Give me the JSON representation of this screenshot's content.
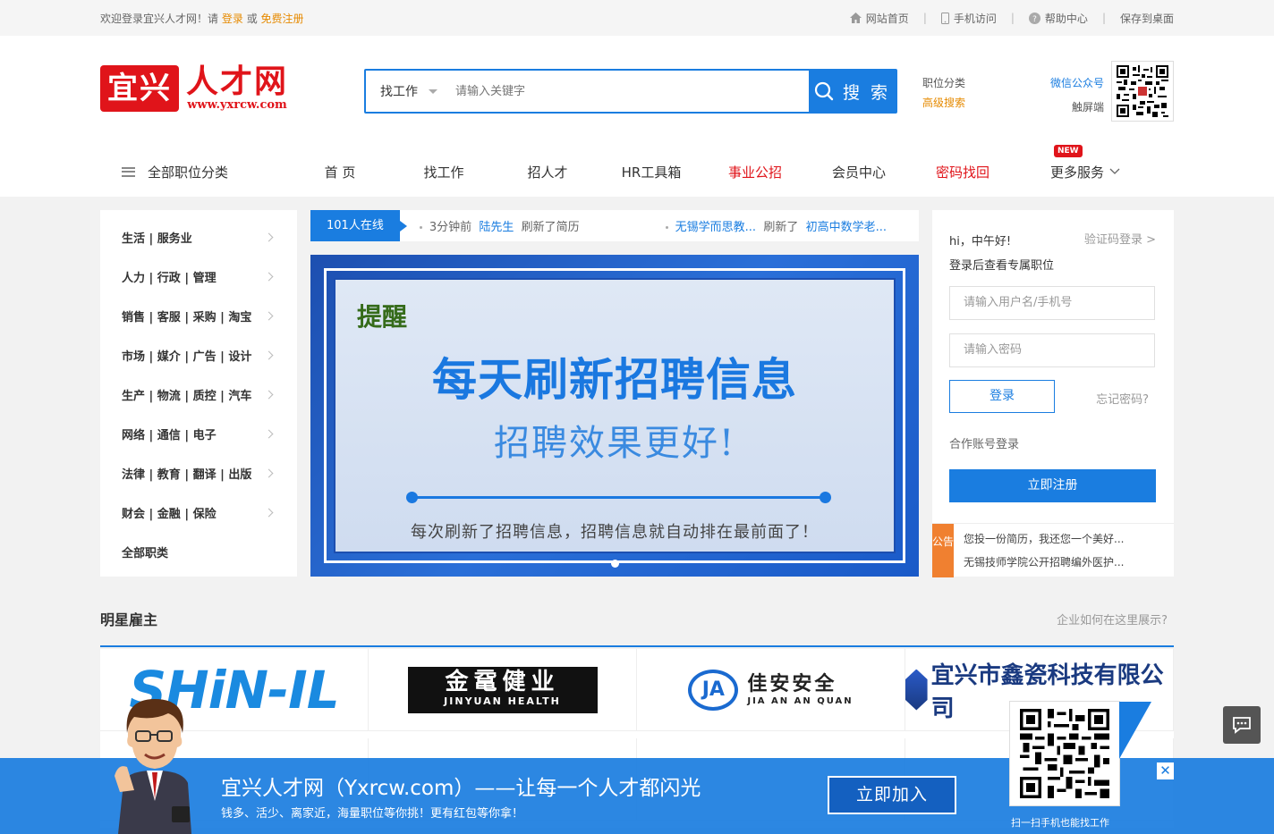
{
  "topbar": {
    "welcome_prefix": "欢迎登录宜兴人才网！请",
    "login": "登录",
    "or": "或",
    "register": "免费注册",
    "links": [
      "网站首页",
      "手机访问",
      "帮助中心",
      "保存到桌面"
    ]
  },
  "logo": {
    "left": "宜兴",
    "right": "人才网",
    "url": "www.yxrcw.com"
  },
  "search": {
    "select": "找工作",
    "placeholder": "请输入关键字",
    "button": "搜 索"
  },
  "adv": {
    "category": "职位分类",
    "advanced": "高级搜索"
  },
  "qr_head": {
    "wechat": "微信公众号",
    "touch": "触屏端"
  },
  "nav": {
    "all_categories": "全部职位分类",
    "items": [
      "首 页",
      "找工作",
      "招人才",
      "HR工具箱",
      "事业公招",
      "会员中心",
      "密码找回"
    ],
    "more": "更多服务",
    "new_badge": "NEW"
  },
  "categories": [
    "生活 | 服务业",
    "人力 | 行政 | 管理",
    "销售 | 客服 | 采购 | 淘宝",
    "市场 | 媒介 | 广告 | 设计",
    "生产 | 物流 | 质控 | 汽车",
    "网络 | 通信 | 电子",
    "法律 | 教育 | 翻译 | 出版",
    "财会 | 金融 | 保险",
    "全部职类"
  ],
  "ticker": {
    "online": "101人在线",
    "item1_time": "3分钟前",
    "item1_user": "陆先生",
    "item1_action": "刷新了简历",
    "item2_company": "无锡学而思教...",
    "item2_action": "刷新了",
    "item2_job": "初高中数学老..."
  },
  "banner": {
    "remind": "提醒",
    "headline": "每天刷新招聘信息",
    "subline": "招聘效果更好!",
    "caption": "每次刷新了招聘信息，招聘信息就自动排在最前面了！"
  },
  "login_panel": {
    "greeting": "hi，中午好!",
    "sub": "登录后查看专属职位",
    "sms_login": "验证码登录 >",
    "user_placeholder": "请输入用户名/手机号",
    "pwd_placeholder": "请输入密码",
    "login_button": "登录",
    "forgot": "忘记密码?",
    "coop": "合作账号登录",
    "register_button": "立即注册"
  },
  "notice": {
    "tag": "公告",
    "items": [
      "您投一份简历，我还您一个美好...",
      "无锡技师学院公开招聘编外医护..."
    ]
  },
  "stars": {
    "title": "明星雇主",
    "question": "企业如何在这里展示?",
    "employers": [
      {
        "type": "text",
        "name": "SHiN-IL"
      },
      {
        "type": "jy",
        "cn": "金鼋健业",
        "en": "JINYUAN HEALTH"
      },
      {
        "type": "ja",
        "cn": "佳安安全",
        "en": "JIA AN AN QUAN",
        "mark": "JA"
      },
      {
        "type": "xc",
        "name": "宜兴市鑫瓷科技有限公司"
      }
    ]
  },
  "bottom_bar": {
    "headline": "宜兴人才网（Yxrcw.com）——让每一个人才都闪光",
    "sub": "钱多、活少、离家近，海量职位等你挑！更有红包等你拿！",
    "join": "立即加入",
    "close": "✕",
    "qr_caption": "扫一扫手机也能找工作"
  },
  "colors": {
    "brand_blue": "#1a7de0",
    "brand_red": "#e0141a",
    "orange": "#e68a00"
  }
}
